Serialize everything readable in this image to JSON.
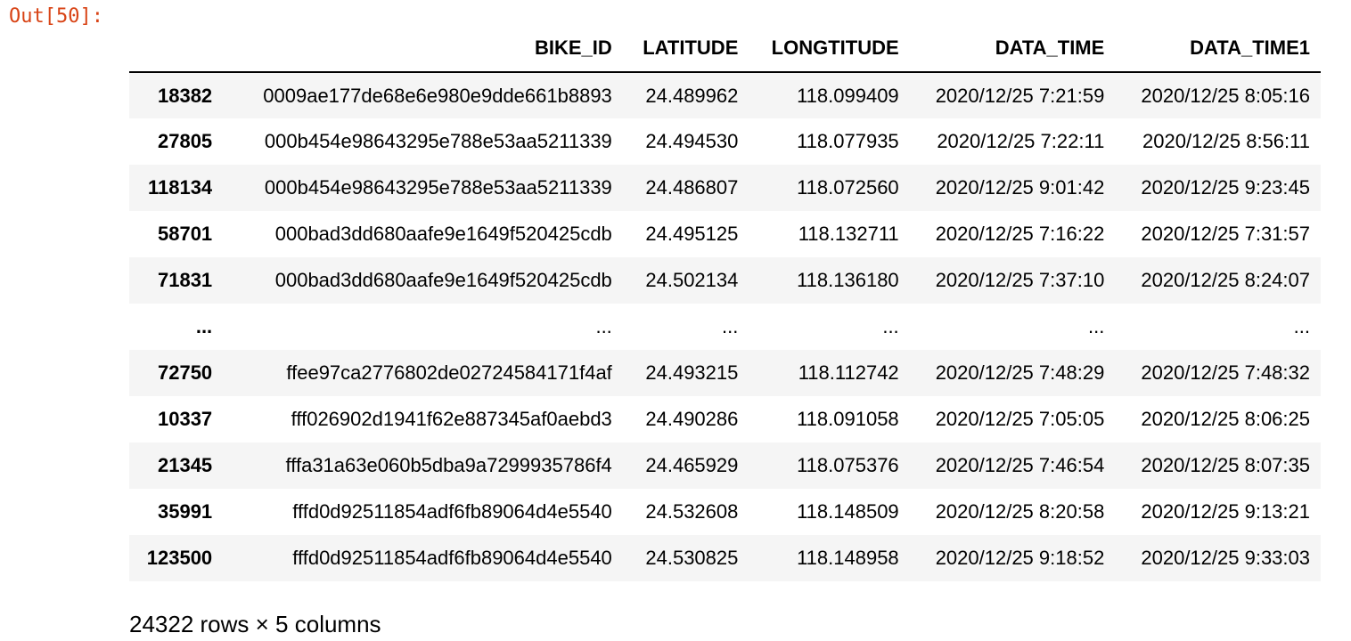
{
  "cell": {
    "out_prompt": "Out[50]:"
  },
  "dataframe": {
    "columns": [
      "",
      "BIKE_ID",
      "LATITUDE",
      "LONGTITUDE",
      "DATA_TIME",
      "DATA_TIME1"
    ],
    "rows": [
      [
        "18382",
        "0009ae177de68e6e980e9dde661b8893",
        "24.489962",
        "118.099409",
        "2020/12/25 7:21:59",
        "2020/12/25 8:05:16"
      ],
      [
        "27805",
        "000b454e98643295e788e53aa5211339",
        "24.494530",
        "118.077935",
        "2020/12/25 7:22:11",
        "2020/12/25 8:56:11"
      ],
      [
        "118134",
        "000b454e98643295e788e53aa5211339",
        "24.486807",
        "118.072560",
        "2020/12/25 9:01:42",
        "2020/12/25 9:23:45"
      ],
      [
        "58701",
        "000bad3dd680aafe9e1649f520425cdb",
        "24.495125",
        "118.132711",
        "2020/12/25 7:16:22",
        "2020/12/25 7:31:57"
      ],
      [
        "71831",
        "000bad3dd680aafe9e1649f520425cdb",
        "24.502134",
        "118.136180",
        "2020/12/25 7:37:10",
        "2020/12/25 8:24:07"
      ],
      [
        "...",
        "...",
        "...",
        "...",
        "...",
        "..."
      ],
      [
        "72750",
        "ffee97ca2776802de02724584171f4af",
        "24.493215",
        "118.112742",
        "2020/12/25 7:48:29",
        "2020/12/25 7:48:32"
      ],
      [
        "10337",
        "fff026902d1941f62e887345af0aebd3",
        "24.490286",
        "118.091058",
        "2020/12/25 7:05:05",
        "2020/12/25 8:06:25"
      ],
      [
        "21345",
        "fffa31a63e060b5dba9a7299935786f4",
        "24.465929",
        "118.075376",
        "2020/12/25 7:46:54",
        "2020/12/25 8:07:35"
      ],
      [
        "35991",
        "fffd0d92511854adf6fb89064d4e5540",
        "24.532608",
        "118.148509",
        "2020/12/25 8:20:58",
        "2020/12/25 9:13:21"
      ],
      [
        "123500",
        "fffd0d92511854adf6fb89064d4e5540",
        "24.530825",
        "118.148958",
        "2020/12/25 9:18:52",
        "2020/12/25 9:33:03"
      ]
    ],
    "shape_caption": "24322 rows × 5 columns"
  },
  "colors": {
    "out_prompt": "#d84315",
    "stripe": "#f5f5f5"
  }
}
